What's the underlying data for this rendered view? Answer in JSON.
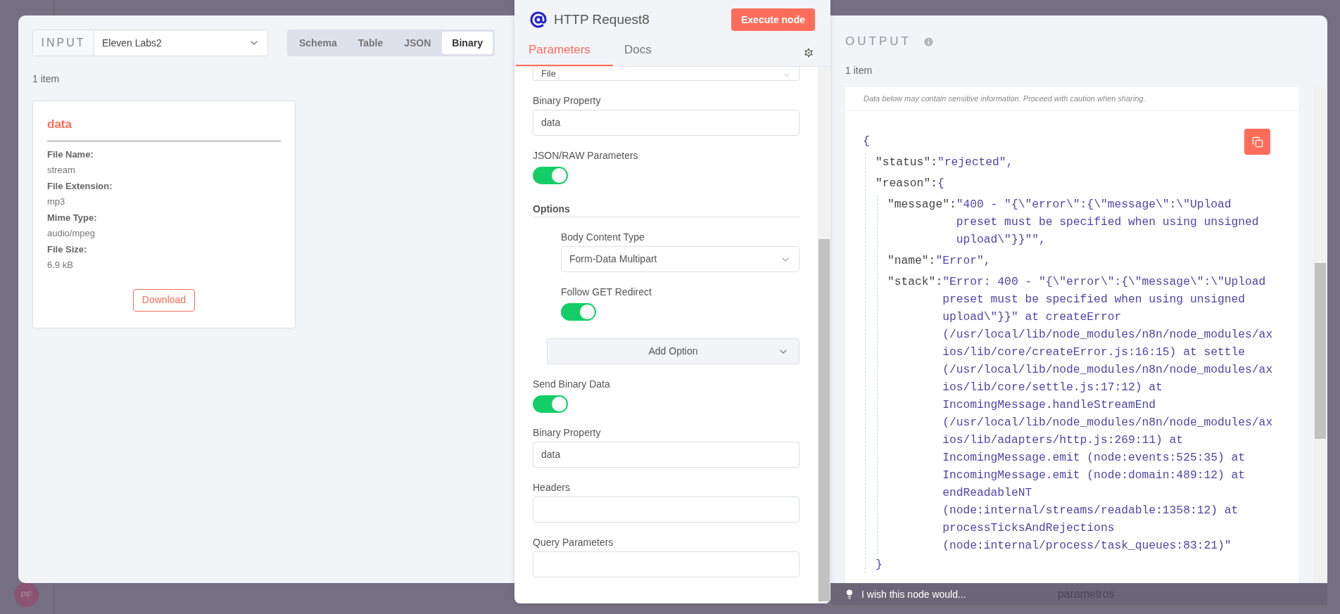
{
  "canvas": {
    "node_label": "parametros",
    "avatar": "PF"
  },
  "input": {
    "label": "INPUT",
    "source": "Eleven Labs2",
    "views": [
      {
        "label": "Schema",
        "selected": false
      },
      {
        "label": "Table",
        "selected": false
      },
      {
        "label": "JSON",
        "selected": false
      },
      {
        "label": "Binary",
        "selected": true
      }
    ],
    "count": "1 item",
    "binary_items": [
      {
        "name": "data",
        "fields": [
          {
            "label": "File Name:",
            "value": "stream"
          },
          {
            "label": "File Extension:",
            "value": "mp3"
          },
          {
            "label": "Mime Type:",
            "value": "audio/mpeg"
          },
          {
            "label": "File Size:",
            "value": "6.9 kB"
          }
        ],
        "action": "Download"
      }
    ]
  },
  "node": {
    "title": "HTTP Request8",
    "execute": "Execute node",
    "tabs": [
      {
        "label": "Parameters",
        "selected": true
      },
      {
        "label": "Docs",
        "selected": false
      }
    ],
    "parameters": [
      {
        "kind": "select",
        "value": "File"
      },
      {
        "kind": "text",
        "label": "Binary Property",
        "value": "data"
      },
      {
        "kind": "toggle",
        "label": "JSON/RAW Parameters",
        "on": true
      },
      {
        "kind": "heading",
        "label": "Options"
      },
      {
        "kind": "group",
        "children": [
          {
            "kind": "select",
            "label": "Body Content Type",
            "value": "Form-Data Multipart"
          },
          {
            "kind": "toggle",
            "label": "Follow GET Redirect",
            "on": true
          },
          {
            "kind": "add",
            "label": "Add Option"
          }
        ]
      },
      {
        "kind": "toggle",
        "label": "Send Binary Data",
        "on": true
      },
      {
        "kind": "text",
        "label": "Binary Property",
        "value": "data"
      },
      {
        "kind": "text",
        "label": "Headers"
      },
      {
        "kind": "text",
        "label": "Query Parameters"
      }
    ]
  },
  "output": {
    "label": "OUTPUT",
    "count": "1 item",
    "notice": "Data below may contain sensitive information. Proceed with caution when sharing.",
    "json": {
      "open": "{",
      "entries": [
        {
          "key": "\"status\":",
          "value": "\"rejected\","
        },
        {
          "key": "\"reason\":",
          "open": "{",
          "children": [
            {
              "key": "\"message\":",
              "value": "\"400 - \"{\\\"error\\\":{\\\"message\\\":\\\"Upload preset must be specified when using unsigned upload\\\"}}\"\","
            },
            {
              "key": "\"name\":",
              "value": "\"Error\","
            },
            {
              "key": "\"stack\":",
              "value": "\"Error: 400 - \"{\\\"error\\\":{\\\"message\\\":\\\"Upload preset must be specified when using unsigned upload\\\"}}\" at createError (/usr/local/lib/node_modules/n8n/node_modules/axios/lib/core/createError.js:16:15) at settle (/usr/local/lib/node_modules/n8n/node_modules/axios/lib/core/settle.js:17:12) at IncomingMessage.handleStreamEnd (/usr/local/lib/node_modules/n8n/node_modules/axios/lib/adapters/http.js:269:11) at IncomingMessage.emit (node:events:525:35) at IncomingMessage.emit (node:domain:489:12) at endReadableNT (node:internal/streams/readable:1358:12) at processTicksAndRejections (node:internal/process/task_queues:83:21)\""
            }
          ],
          "close": "}"
        }
      ]
    }
  },
  "feedback": {
    "text": "I wish this node would..."
  }
}
